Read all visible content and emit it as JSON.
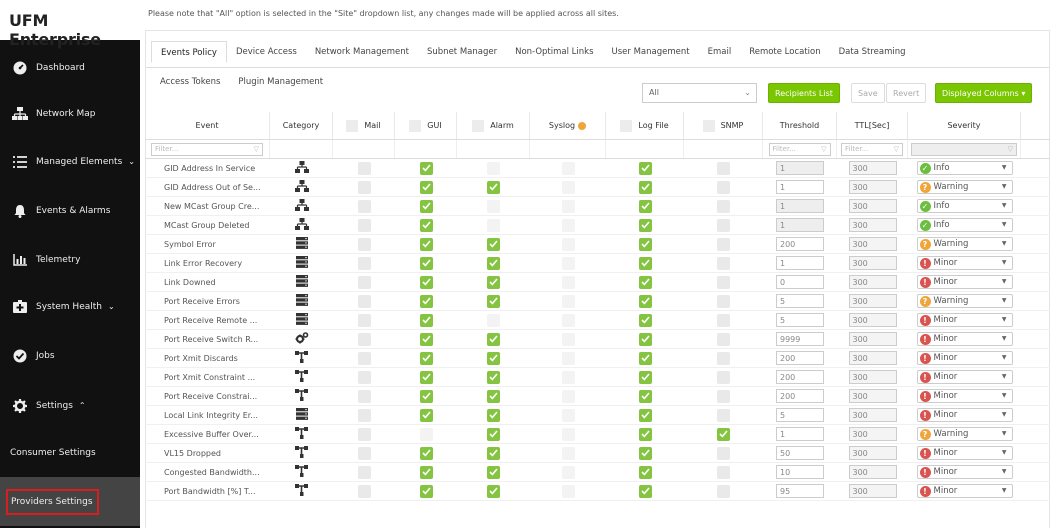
{
  "app": {
    "title": "UFM Enterprise"
  },
  "sidebar": {
    "items": [
      {
        "label": "Dashboard",
        "icon": "dashboard-icon",
        "chevron": ""
      },
      {
        "label": "Network Map",
        "icon": "network-map-icon",
        "chevron": ""
      },
      {
        "label": "Managed Elements",
        "icon": "managed-elements-icon",
        "chevron": "⌄"
      },
      {
        "label": "Events & Alarms",
        "icon": "bell-icon",
        "chevron": ""
      },
      {
        "label": "Telemetry",
        "icon": "telemetry-icon",
        "chevron": ""
      },
      {
        "label": "System Health",
        "icon": "system-health-icon",
        "chevron": "⌄"
      },
      {
        "label": "Jobs",
        "icon": "jobs-icon",
        "chevron": ""
      },
      {
        "label": "Settings",
        "icon": "gear-icon",
        "chevron": "⌃"
      }
    ],
    "sub_items": [
      {
        "label": "Consumer Settings"
      },
      {
        "label": "Providers Settings"
      }
    ]
  },
  "notice": "Please note that \"All\" option is selected in the \"Site\" dropdown list, any changes made will be applied across all sites.",
  "tabs_row1": [
    "Events Policy",
    "Device Access",
    "Network Management",
    "Subnet Manager",
    "Non-Optimal Links",
    "User Management",
    "Email",
    "Remote Location",
    "Data Streaming"
  ],
  "tabs_row2": [
    "Access Tokens",
    "Plugin Management"
  ],
  "toolbar": {
    "site_value": "All",
    "recipients_label": "Recipients List",
    "save_label": "Save",
    "revert_label": "Revert",
    "columns_label": "Displayed Columns ▾"
  },
  "grid": {
    "headers": {
      "event": "Event",
      "category": "Category",
      "mail": "Mail",
      "gui": "GUI",
      "alarm": "Alarm",
      "syslog": "Syslog",
      "logfile": "Log File",
      "snmp": "SNMP",
      "threshold": "Threshold",
      "ttl": "TTL[Sec]",
      "severity": "Severity"
    },
    "filter_placeholder": "Filter...",
    "severity_colors": {
      "Info": "#6cbf3e",
      "Warning": "#f0a53a",
      "Minor": "#d9534f"
    },
    "rows": [
      {
        "event": "GID Address In Service",
        "cat": "network",
        "mail": "off",
        "gui": "on",
        "alarm": "dis",
        "syslog": "dis",
        "log": "on",
        "snmp": "off",
        "thr": "1",
        "thr_ro": true,
        "ttl": "300",
        "sev": "Info"
      },
      {
        "event": "GID Address Out of Se...",
        "cat": "network",
        "mail": "off",
        "gui": "on",
        "alarm": "on",
        "syslog": "dis",
        "log": "on",
        "snmp": "off",
        "thr": "1",
        "thr_ro": false,
        "ttl": "300",
        "sev": "Warning"
      },
      {
        "event": "New MCast Group Cre...",
        "cat": "network",
        "mail": "off",
        "gui": "on",
        "alarm": "dis",
        "syslog": "dis",
        "log": "on",
        "snmp": "off",
        "thr": "1",
        "thr_ro": true,
        "ttl": "300",
        "sev": "Info"
      },
      {
        "event": "MCast Group Deleted",
        "cat": "network",
        "mail": "off",
        "gui": "on",
        "alarm": "dis",
        "syslog": "dis",
        "log": "on",
        "snmp": "off",
        "thr": "1",
        "thr_ro": true,
        "ttl": "300",
        "sev": "Info"
      },
      {
        "event": "Symbol Error",
        "cat": "server",
        "mail": "off",
        "gui": "on",
        "alarm": "on",
        "syslog": "dis",
        "log": "on",
        "snmp": "off",
        "thr": "200",
        "thr_ro": false,
        "ttl": "300",
        "sev": "Warning"
      },
      {
        "event": "Link Error Recovery",
        "cat": "server",
        "mail": "off",
        "gui": "on",
        "alarm": "on",
        "syslog": "dis",
        "log": "on",
        "snmp": "off",
        "thr": "1",
        "thr_ro": false,
        "ttl": "300",
        "sev": "Minor"
      },
      {
        "event": "Link Downed",
        "cat": "server",
        "mail": "off",
        "gui": "on",
        "alarm": "on",
        "syslog": "dis",
        "log": "on",
        "snmp": "off",
        "thr": "0",
        "thr_ro": false,
        "ttl": "300",
        "sev": "Minor"
      },
      {
        "event": "Port Receive Errors",
        "cat": "server",
        "mail": "off",
        "gui": "on",
        "alarm": "on",
        "syslog": "dis",
        "log": "on",
        "snmp": "off",
        "thr": "5",
        "thr_ro": false,
        "ttl": "300",
        "sev": "Warning"
      },
      {
        "event": "Port Receive Remote ...",
        "cat": "server",
        "mail": "off",
        "gui": "on",
        "alarm": "dis",
        "syslog": "dis",
        "log": "on",
        "snmp": "off",
        "thr": "5",
        "thr_ro": false,
        "ttl": "300",
        "sev": "Minor"
      },
      {
        "event": "Port Receive Switch R...",
        "cat": "gears",
        "mail": "off",
        "gui": "on",
        "alarm": "on",
        "syslog": "dis",
        "log": "on",
        "snmp": "off",
        "thr": "9999",
        "thr_ro": false,
        "ttl": "300",
        "sev": "Minor"
      },
      {
        "event": "Port Xmit Discards",
        "cat": "topology",
        "mail": "off",
        "gui": "on",
        "alarm": "on",
        "syslog": "dis",
        "log": "on",
        "snmp": "off",
        "thr": "200",
        "thr_ro": false,
        "ttl": "300",
        "sev": "Minor"
      },
      {
        "event": "Port Xmit Constraint ...",
        "cat": "topology",
        "mail": "off",
        "gui": "on",
        "alarm": "on",
        "syslog": "dis",
        "log": "on",
        "snmp": "off",
        "thr": "200",
        "thr_ro": false,
        "ttl": "300",
        "sev": "Minor"
      },
      {
        "event": "Port Receive Constrai...",
        "cat": "topology",
        "mail": "off",
        "gui": "on",
        "alarm": "on",
        "syslog": "dis",
        "log": "on",
        "snmp": "off",
        "thr": "200",
        "thr_ro": false,
        "ttl": "300",
        "sev": "Minor"
      },
      {
        "event": "Local Link Integrity Er...",
        "cat": "server",
        "mail": "off",
        "gui": "on",
        "alarm": "on",
        "syslog": "dis",
        "log": "on",
        "snmp": "off",
        "thr": "5",
        "thr_ro": false,
        "ttl": "300",
        "sev": "Minor"
      },
      {
        "event": "Excessive Buffer Over...",
        "cat": "topology",
        "mail": "off",
        "gui": "dis",
        "alarm": "on",
        "syslog": "dis",
        "log": "on",
        "snmp": "on",
        "thr": "1",
        "thr_ro": false,
        "ttl": "300",
        "sev": "Warning"
      },
      {
        "event": "VL15 Dropped",
        "cat": "topology",
        "mail": "off",
        "gui": "on",
        "alarm": "on",
        "syslog": "dis",
        "log": "on",
        "snmp": "off",
        "thr": "50",
        "thr_ro": false,
        "ttl": "300",
        "sev": "Minor"
      },
      {
        "event": "Congested Bandwidth...",
        "cat": "topology",
        "mail": "off",
        "gui": "on",
        "alarm": "on",
        "syslog": "dis",
        "log": "on",
        "snmp": "off",
        "thr": "10",
        "thr_ro": false,
        "ttl": "300",
        "sev": "Minor"
      },
      {
        "event": "Port Bandwidth [%] T...",
        "cat": "topology",
        "mail": "off",
        "gui": "on",
        "alarm": "on",
        "syslog": "dis",
        "log": "on",
        "snmp": "off",
        "thr": "95",
        "thr_ro": false,
        "ttl": "300",
        "sev": "Minor"
      }
    ]
  }
}
